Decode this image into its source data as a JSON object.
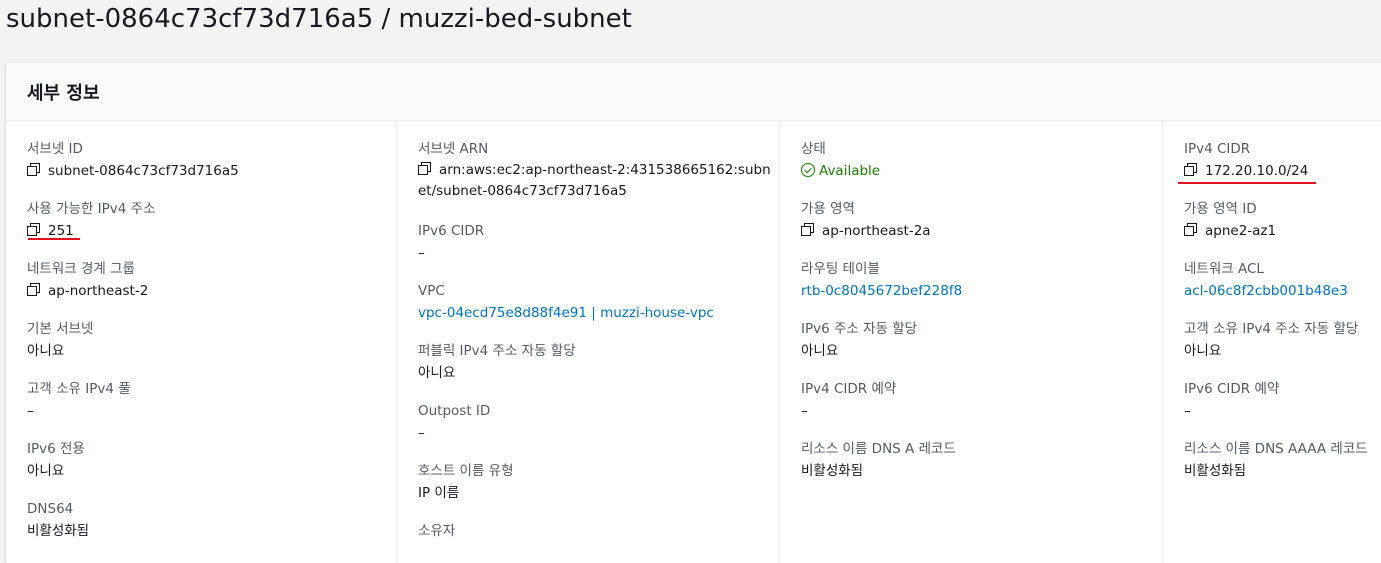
{
  "page_title": "subnet-0864c73cf73d716a5 / muzzi-bed-subnet",
  "panel_title": "세부 정보",
  "columns": {
    "c1": {
      "subnet_id": {
        "label": "서브넷 ID",
        "value": "subnet-0864c73cf73d716a5"
      },
      "available_ipv4": {
        "label": "사용 가능한 IPv4 주소",
        "value": "251"
      },
      "network_border_group": {
        "label": "네트워크 경계 그룹",
        "value": "ap-northeast-2"
      },
      "default_subnet": {
        "label": "기본 서브넷",
        "value": "아니요"
      },
      "customer_owned_pool": {
        "label": "고객 소유 IPv4 풀",
        "value": "–"
      },
      "ipv6_only": {
        "label": "IPv6 전용",
        "value": "아니요"
      },
      "dns64": {
        "label": "DNS64",
        "value": "비활성화됨"
      }
    },
    "c2": {
      "subnet_arn": {
        "label": "서브넷 ARN",
        "value": "arn:aws:ec2:ap-northeast-2:431538665162:subnet/subnet-0864c73cf73d716a5"
      },
      "ipv6_cidr": {
        "label": "IPv6 CIDR",
        "value": "–"
      },
      "vpc": {
        "label": "VPC",
        "value": "vpc-04ecd75e8d88f4e91 | muzzi-house-vpc"
      },
      "auto_assign_public_ipv4": {
        "label": "퍼블릭 IPv4 주소 자동 할당",
        "value": "아니요"
      },
      "outpost_id": {
        "label": "Outpost ID",
        "value": "–"
      },
      "hostname_type": {
        "label": "호스트 이름 유형",
        "value": "IP 이름"
      },
      "owner": {
        "label": "소유자",
        "value": ""
      }
    },
    "c3": {
      "state": {
        "label": "상태",
        "value": "Available"
      },
      "availability_zone": {
        "label": "가용 영역",
        "value": "ap-northeast-2a"
      },
      "route_table": {
        "label": "라우팅 테이블",
        "value": "rtb-0c8045672bef228f8"
      },
      "auto_assign_ipv6": {
        "label": "IPv6 주소 자동 할당",
        "value": "아니요"
      },
      "ipv4_cidr_reservations": {
        "label": "IPv4 CIDR 예약",
        "value": "–"
      },
      "dns_a_record": {
        "label": "리소스 이름 DNS A 레코드",
        "value": "비활성화됨"
      }
    },
    "c4": {
      "ipv4_cidr": {
        "label": "IPv4 CIDR",
        "value": "172.20.10.0/24"
      },
      "az_id": {
        "label": "가용 영역 ID",
        "value": "apne2-az1"
      },
      "network_acl": {
        "label": "네트워크 ACL",
        "value": "acl-06c8f2cbb001b48e3"
      },
      "auto_assign_customer_ipv4": {
        "label": "고객 소유 IPv4 주소 자동 할당",
        "value": "아니요"
      },
      "ipv6_cidr_reservations": {
        "label": "IPv6 CIDR 예약",
        "value": "–"
      },
      "dns_aaaa_record": {
        "label": "리소스 이름 DNS AAAA 레코드",
        "value": "비활성화됨"
      }
    }
  },
  "colors": {
    "link": "#0073bb",
    "available": "#1d8102",
    "annotation_underline": "#e0141e"
  }
}
